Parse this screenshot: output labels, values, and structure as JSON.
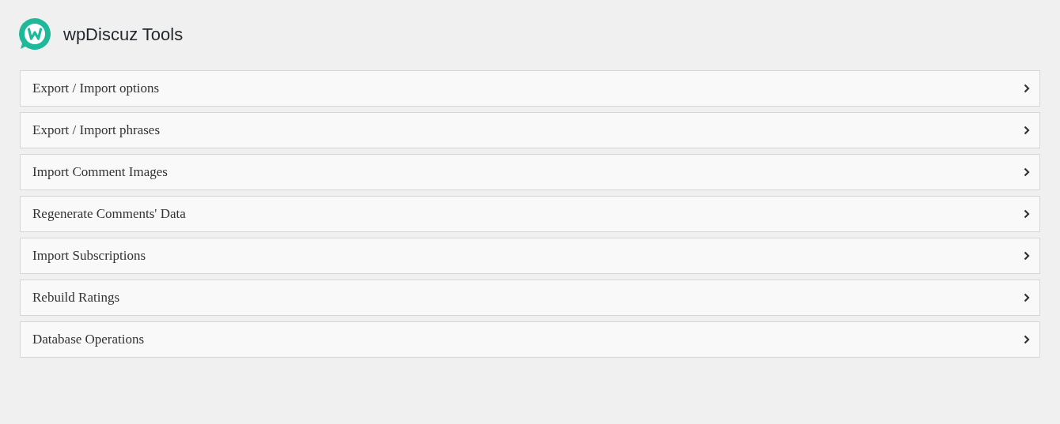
{
  "header": {
    "title": "wpDiscuz Tools"
  },
  "sections": [
    {
      "label": "Export / Import options"
    },
    {
      "label": "Export / Import phrases"
    },
    {
      "label": "Import Comment Images"
    },
    {
      "label": "Regenerate Comments' Data"
    },
    {
      "label": "Import Subscriptions"
    },
    {
      "label": "Rebuild Ratings"
    },
    {
      "label": "Database Operations"
    }
  ]
}
